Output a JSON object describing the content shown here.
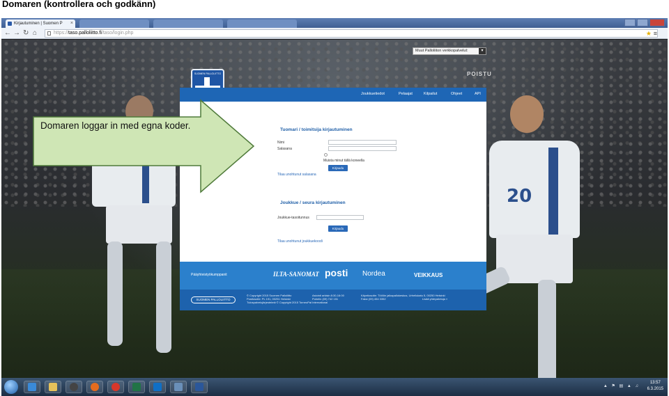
{
  "slide": {
    "title": "Domaren (kontrollera och godkänn)",
    "callout_text": "Domaren loggar in med egna koder."
  },
  "browser": {
    "tab_title": "Kirjautuminen | Suomen P",
    "tab_close": "×",
    "url_scheme": "https://",
    "url_host": "taso.palloliitto.fi",
    "url_path": "/taso/login.php"
  },
  "page": {
    "external_dropdown": "Muut Palloliiton verkkopalvelut:",
    "logout": "POISTU",
    "crest_text": "SUOMEN PALLOLIITTO",
    "nav": [
      "Joukkuetiedot",
      "Pelaajat",
      "Kilpailut",
      "Ohjeet",
      "API"
    ],
    "referee_login": {
      "title": "Tuomari / toimitsija kirjautuminen",
      "name_label": "Nimi",
      "password_label": "Salasana",
      "remember_label": "Muista minut tällä koneella",
      "submit": "Kirjaudu",
      "forgot_link": "Tilaa unohtunut salasana"
    },
    "team_login": {
      "title": "Joukkue / seura kirjautuminen",
      "code_label": "Joukkue-tasoitunnus",
      "submit": "Kirjaudu",
      "forgot_link": "Tilaa unohtunut joukkuekoodi"
    },
    "sponsors": {
      "label": "Pääyhteistyökumppanit",
      "logos": [
        "ILTA-SANOMAT",
        "posti",
        "Nordea",
        "VEIKKAUS"
      ]
    },
    "footer": {
      "badge": "SUOMEN PALLOLIITTO",
      "col1": [
        "© Copyright 2015 Suomen Palloliitto",
        "Postiosoite: PL 191, 00251 Helsinki",
        "Tulospalvelujärjestelmä © Copyright 2015 TorneoPal International"
      ],
      "col2": [
        "Asiointi arkisin 8:30-16:00",
        "Puhelin (09) 742 151"
      ],
      "col3": [
        "Käyntiosoite: Töölön jalkapallokeskus, Urheilukatu 5, 00250 Helsinki",
        "Faksi (09) 454 3352"
      ],
      "col4": [
        "Lisää yhteystietoja »"
      ]
    }
  },
  "taskbar": {
    "clock_time": "13:57",
    "clock_date": "6.3.2015"
  }
}
